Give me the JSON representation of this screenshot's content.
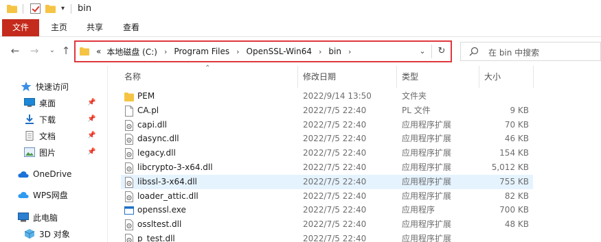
{
  "window": {
    "title": "bin"
  },
  "ribbon": {
    "tabs": [
      "文件",
      "主页",
      "共享",
      "查看"
    ]
  },
  "address": {
    "overflow": "«",
    "crumbs": [
      "本地磁盘 (C:)",
      "Program Files",
      "OpenSSL-Win64",
      "bin"
    ]
  },
  "search": {
    "placeholder": "在 bin 中搜索"
  },
  "sidebar": {
    "items": [
      {
        "label": "快速访问",
        "icon": "star-icon"
      },
      {
        "label": "桌面",
        "icon": "desktop-icon",
        "pinned": true
      },
      {
        "label": "下载",
        "icon": "download-icon",
        "pinned": true
      },
      {
        "label": "文档",
        "icon": "document-icon",
        "pinned": true
      },
      {
        "label": "图片",
        "icon": "picture-icon",
        "pinned": true
      },
      {
        "label": "OneDrive",
        "icon": "cloud-icon"
      },
      {
        "label": "WPS网盘",
        "icon": "wps-cloud-icon"
      },
      {
        "label": "此电脑",
        "icon": "computer-icon"
      },
      {
        "label": "3D 对象",
        "icon": "cube-icon"
      }
    ]
  },
  "columns": {
    "name": "名称",
    "date": "修改日期",
    "type": "类型",
    "size": "大小"
  },
  "files": [
    {
      "name": "PEM",
      "date": "2022/9/14 13:50",
      "type": "文件夹",
      "size": "",
      "icon": "folder-icon"
    },
    {
      "name": "CA.pl",
      "date": "2022/7/5 22:40",
      "type": "PL 文件",
      "size": "9 KB",
      "icon": "file-icon"
    },
    {
      "name": "capi.dll",
      "date": "2022/7/5 22:40",
      "type": "应用程序扩展",
      "size": "70 KB",
      "icon": "dll-icon"
    },
    {
      "name": "dasync.dll",
      "date": "2022/7/5 22:40",
      "type": "应用程序扩展",
      "size": "46 KB",
      "icon": "dll-icon"
    },
    {
      "name": "legacy.dll",
      "date": "2022/7/5 22:40",
      "type": "应用程序扩展",
      "size": "154 KB",
      "icon": "dll-icon"
    },
    {
      "name": "libcrypto-3-x64.dll",
      "date": "2022/7/5 22:40",
      "type": "应用程序扩展",
      "size": "5,012 KB",
      "icon": "dll-icon"
    },
    {
      "name": "libssl-3-x64.dll",
      "date": "2022/7/5 22:40",
      "type": "应用程序扩展",
      "size": "755 KB",
      "icon": "dll-icon",
      "selected": true
    },
    {
      "name": "loader_attic.dll",
      "date": "2022/7/5 22:40",
      "type": "应用程序扩展",
      "size": "82 KB",
      "icon": "dll-icon"
    },
    {
      "name": "openssl.exe",
      "date": "2022/7/5 22:40",
      "type": "应用程序",
      "size": "700 KB",
      "icon": "exe-icon"
    },
    {
      "name": "ossltest.dll",
      "date": "2022/7/5 22:40",
      "type": "应用程序扩展",
      "size": "48 KB",
      "icon": "dll-icon"
    },
    {
      "name": "p_test.dll",
      "date": "2022/7/5 22:40",
      "type": "应用程序扩展",
      "size": "",
      "icon": "dll-icon"
    }
  ],
  "colors": {
    "accent": "#c42b1c",
    "highlight": "#e0363c",
    "selection": "#e5f3ff",
    "folder": "#f5c445"
  }
}
